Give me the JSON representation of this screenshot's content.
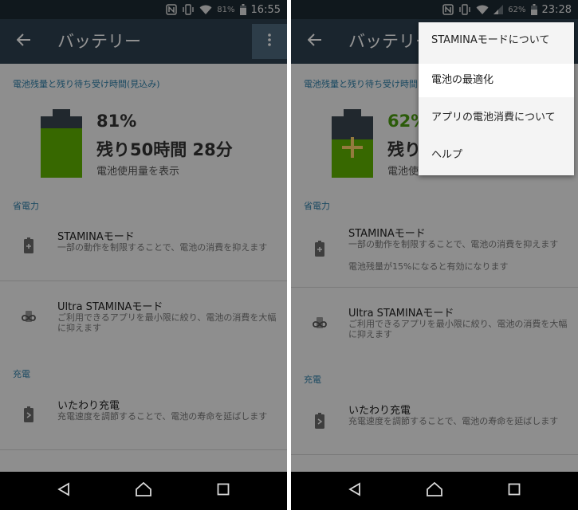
{
  "left": {
    "status": {
      "battery_percent": "81%",
      "time": "16:55"
    },
    "appbar": {
      "title": "バッテリー"
    },
    "battery_section_header": "電池残量と残り待ち受け時間(見込み)",
    "battery": {
      "percent": "81%",
      "fill_level": 0.81,
      "remaining": "残り50時間 28分",
      "usage_link": "電池使用量を表示"
    },
    "power_saving_header": "省電力",
    "stamina": {
      "title": "STAMINAモード",
      "desc": "一部の動作を制限することで、電池の消費を抑えます"
    },
    "ultra_stamina": {
      "title": "Ultra STAMINAモード",
      "desc": "ご利用できるアプリを最小限に絞り、電池の消費を大幅に抑えます"
    },
    "charging_header": "充電",
    "care_charging": {
      "title": "いたわり充電",
      "desc": "充電速度を調節することで、電池の寿命を延ばします"
    }
  },
  "right": {
    "status": {
      "battery_percent": "62%",
      "time": "23:28"
    },
    "appbar": {
      "title": "バッテリー"
    },
    "battery_section_header": "電池残量と残り待ち受け時間(見込み)",
    "battery": {
      "percent": "62%",
      "fill_level": 0.62,
      "remaining": "残り",
      "usage_link": "電池使"
    },
    "power_saving_header": "省電力",
    "stamina": {
      "title": "STAMINAモード",
      "desc": "一部の動作を制限することで、電池の消費を抑えます",
      "desc2": "電池残量が15%になると有効になります"
    },
    "ultra_stamina": {
      "title": "Ultra STAMINAモード",
      "desc": "ご利用できるアプリを最小限に絞り、電池の消費を大幅に抑えます"
    },
    "charging_header": "充電",
    "care_charging": {
      "title": "いたわり充電",
      "desc": "充電速度を調節することで、電池の寿命を延ばします"
    },
    "menu": [
      {
        "label": "STAMINAモードについて"
      },
      {
        "label": "電池の最適化"
      },
      {
        "label": "アプリの電池消費について"
      },
      {
        "label": "ヘルプ"
      }
    ]
  },
  "icons": {
    "nfc": "nfc-icon",
    "vibrate": "vibrate-icon",
    "wifi": "wifi-icon",
    "signal": "signal-icon",
    "battery_status": "battery-status-icon",
    "back": "back-arrow-icon",
    "overflow": "more-vert-icon",
    "stamina": "battery-plus-icon",
    "ultra_stamina": "infinity-battery-icon",
    "care": "battery-heart-icon",
    "nav_back": "nav-back-icon",
    "nav_home": "nav-home-icon",
    "nav_recents": "nav-recents-icon"
  },
  "colors": {
    "appbar": "#2d4050",
    "statusbar": "#1d2a33",
    "accent": "#2e7fa8",
    "battery_green": "#5fb300"
  }
}
